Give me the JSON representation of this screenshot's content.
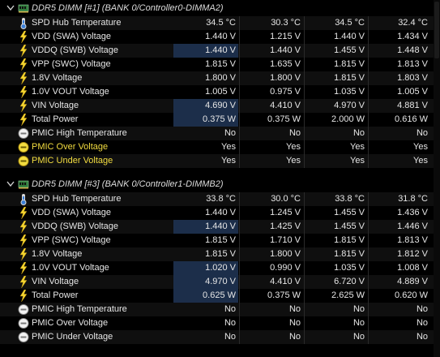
{
  "sections": [
    {
      "title": "DDR5 DIMM [#1] (BANK 0/Controller0-DIMMA2)",
      "rows": [
        {
          "icon": "thermometer-icon",
          "label": "SPD Hub Temperature",
          "values": [
            "34.5 °C",
            "30.3 °C",
            "34.5 °C",
            "32.4 °C"
          ],
          "yellow": false,
          "hl": false
        },
        {
          "icon": "lightning-icon",
          "label": "VDD (SWA) Voltage",
          "values": [
            "1.440 V",
            "1.215 V",
            "1.440 V",
            "1.434 V"
          ],
          "yellow": false,
          "hl": false
        },
        {
          "icon": "lightning-icon",
          "label": "VDDQ (SWB) Voltage",
          "values": [
            "1.440 V",
            "1.440 V",
            "1.455 V",
            "1.448 V"
          ],
          "yellow": false,
          "hl": true
        },
        {
          "icon": "lightning-icon",
          "label": "VPP (SWC) Voltage",
          "values": [
            "1.815 V",
            "1.635 V",
            "1.815 V",
            "1.813 V"
          ],
          "yellow": false,
          "hl": false
        },
        {
          "icon": "lightning-icon",
          "label": "1.8V Voltage",
          "values": [
            "1.800 V",
            "1.800 V",
            "1.815 V",
            "1.803 V"
          ],
          "yellow": false,
          "hl": false
        },
        {
          "icon": "lightning-icon",
          "label": "1.0V VOUT Voltage",
          "values": [
            "1.005 V",
            "0.975 V",
            "1.035 V",
            "1.005 V"
          ],
          "yellow": false,
          "hl": false
        },
        {
          "icon": "lightning-icon",
          "label": "VIN Voltage",
          "values": [
            "4.690 V",
            "4.410 V",
            "4.970 V",
            "4.881 V"
          ],
          "yellow": false,
          "hl": true
        },
        {
          "icon": "lightning-icon",
          "label": "Total Power",
          "values": [
            "0.375 W",
            "0.375 W",
            "2.000 W",
            "0.616 W"
          ],
          "yellow": false,
          "hl": true
        },
        {
          "icon": "gauge-icon",
          "label": "PMIC High Temperature",
          "values": [
            "No",
            "No",
            "No",
            "No"
          ],
          "yellow": false,
          "hl": false
        },
        {
          "icon": "warning-gauge-icon",
          "label": "PMIC Over Voltage",
          "values": [
            "Yes",
            "Yes",
            "Yes",
            "Yes"
          ],
          "yellow": true,
          "hl": false
        },
        {
          "icon": "warning-gauge-icon",
          "label": "PMIC Under Voltage",
          "values": [
            "Yes",
            "Yes",
            "Yes",
            "Yes"
          ],
          "yellow": true,
          "hl": false
        }
      ]
    },
    {
      "title": "DDR5 DIMM [#3] (BANK 0/Controller1-DIMMB2)",
      "rows": [
        {
          "icon": "thermometer-icon",
          "label": "SPD Hub Temperature",
          "values": [
            "33.8 °C",
            "30.0 °C",
            "33.8 °C",
            "31.8 °C"
          ],
          "yellow": false,
          "hl": false
        },
        {
          "icon": "lightning-icon",
          "label": "VDD (SWA) Voltage",
          "values": [
            "1.440 V",
            "1.245 V",
            "1.455 V",
            "1.436 V"
          ],
          "yellow": false,
          "hl": false
        },
        {
          "icon": "lightning-icon",
          "label": "VDDQ (SWB) Voltage",
          "values": [
            "1.440 V",
            "1.425 V",
            "1.455 V",
            "1.446 V"
          ],
          "yellow": false,
          "hl": true
        },
        {
          "icon": "lightning-icon",
          "label": "VPP (SWC) Voltage",
          "values": [
            "1.815 V",
            "1.710 V",
            "1.815 V",
            "1.813 V"
          ],
          "yellow": false,
          "hl": false
        },
        {
          "icon": "lightning-icon",
          "label": "1.8V Voltage",
          "values": [
            "1.815 V",
            "1.800 V",
            "1.815 V",
            "1.812 V"
          ],
          "yellow": false,
          "hl": false
        },
        {
          "icon": "lightning-icon",
          "label": "1.0V VOUT Voltage",
          "values": [
            "1.020 V",
            "0.990 V",
            "1.035 V",
            "1.008 V"
          ],
          "yellow": false,
          "hl": true
        },
        {
          "icon": "lightning-icon",
          "label": "VIN Voltage",
          "values": [
            "4.970 V",
            "4.410 V",
            "6.720 V",
            "4.889 V"
          ],
          "yellow": false,
          "hl": true
        },
        {
          "icon": "lightning-icon",
          "label": "Total Power",
          "values": [
            "0.625 W",
            "0.375 W",
            "2.625 W",
            "0.620 W"
          ],
          "yellow": false,
          "hl": true
        },
        {
          "icon": "gauge-icon",
          "label": "PMIC High Temperature",
          "values": [
            "No",
            "No",
            "No",
            "No"
          ],
          "yellow": false,
          "hl": false
        },
        {
          "icon": "gauge-icon",
          "label": "PMIC Over Voltage",
          "values": [
            "No",
            "No",
            "No",
            "No"
          ],
          "yellow": false,
          "hl": false
        },
        {
          "icon": "gauge-icon",
          "label": "PMIC Under Voltage",
          "values": [
            "No",
            "No",
            "No",
            "No"
          ],
          "yellow": false,
          "hl": false
        }
      ]
    }
  ],
  "colors": {
    "yellow": "#f3dd40",
    "highlight": "#1c2e4a",
    "background": "#000000"
  }
}
